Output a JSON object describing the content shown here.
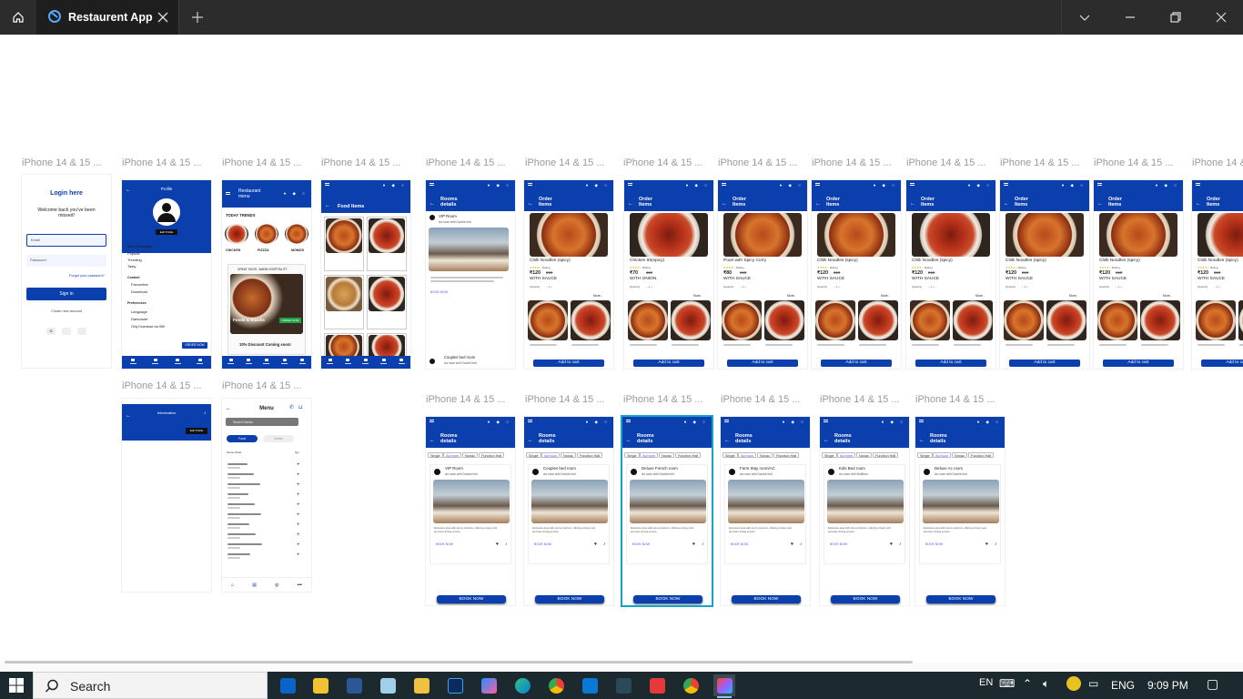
{
  "window": {
    "tab_title": "Restaurent App",
    "brand_color": "#0b3fae",
    "selection_color": "#12a3cf"
  },
  "canvas": {
    "frame_label": "iPhone 14 & 15 ...",
    "login": {
      "title": "Login here",
      "subtitle": "Welcome back you've been missed!",
      "email_placeholder": "Email",
      "password_placeholder": "Password",
      "forgot": "Forgot your password?",
      "signin": "Sign in",
      "create": "Create new account"
    },
    "profile": {
      "title": "Profile",
      "edit": "Edit Profile",
      "section_most": "Most Favourites",
      "most_items": [
        "Popular",
        "Trending",
        "Tasty"
      ],
      "section_content": "Content",
      "content_items": [
        "Favourites",
        "Download"
      ],
      "section_pref": "Preferences",
      "pref_items": [
        "Language",
        "Darkmode",
        "Only Download via Wifi"
      ],
      "order_btn": "ORDER NOW"
    },
    "restaurant_menu": {
      "title": "Restaurant menu",
      "trends": "TODAY TRENDS",
      "dishes": [
        "CHICKEN",
        "PIZZZA",
        "MOMOS"
      ],
      "tagline": "GREAT TASTE, WARM HOSPITALITY",
      "banner": "Foods & Snacks",
      "banner_btn": "ORDER NOW",
      "discount": "10% Discount Coming soon!"
    },
    "food_items": {
      "title": "Food Items"
    },
    "rooms_details": {
      "title": "Rooms details",
      "room1": "VIP Room",
      "room1_sub": "Aa room with Double bed",
      "book_link": "BOOK NOW",
      "room2": "Couples bed room",
      "room2_sub": "Aa room with Double bed"
    },
    "order_items": {
      "title": "Order Items",
      "more": "More..",
      "quantity": "Quantity",
      "rating": "Rating",
      "add_to_cart": "Add to cart",
      "cards": [
        {
          "name": "Chilli Noodles (spicy)",
          "price": "₹120",
          "old": "210",
          "extra": "WITH SAUCE"
        },
        {
          "name": "Chicken 65(spicy)",
          "price": "₹70",
          "old": "110",
          "extra": "WITH ONION"
        },
        {
          "name": "Poori with Spicy Curry",
          "price": "₹80",
          "old": "210",
          "extra": "WITH SAUCE"
        },
        {
          "name": "Chilli Noodles (spicy)",
          "price": "₹120",
          "old": "210",
          "extra": "WITH SAUCE"
        },
        {
          "name": "Chilli Noodles (spicy)",
          "price": "₹120",
          "old": "210",
          "extra": "WITH SAUCE"
        },
        {
          "name": "Chilli Noodles (spicy)",
          "price": "₹120",
          "old": "210",
          "extra": "WITH SAUCE"
        },
        {
          "name": "Chilli Noodles (spicy)",
          "price": "₹120",
          "old": "210",
          "extra": "WITH SAUCE"
        },
        {
          "name": "Chilli Noodles (spicy)",
          "price": "₹120",
          "old": "210",
          "extra": "WITH SAUCE"
        }
      ]
    },
    "information": {
      "title": "Information",
      "edit": "Edit Profile"
    },
    "menu": {
      "title": "Menu",
      "search": "Search Dishes",
      "tab_food": "Food",
      "tab_drinks": "Drinks",
      "col_header": "Name Order",
      "col_qty": "Qty"
    },
    "rooms_list": {
      "title": "Rooms details",
      "chips": [
        "Single",
        "Ac/room",
        "Nonac",
        "Function Hall"
      ],
      "book_now": "BOOK NOW",
      "book_link": "BOOK NOW",
      "desc": "Exclusive area with luxury interiors, offering privacy and premium dining service.",
      "rooms": [
        {
          "name": "VIP Room",
          "sub": "Aa room with Double bed"
        },
        {
          "name": "Couples bed room",
          "sub": "Aa room with Double bed"
        },
        {
          "name": "Deluxe French room",
          "sub": "Aa room with Double bed"
        },
        {
          "name": "Farm Stay room/AC",
          "sub": "Aa room with Double bed"
        },
        {
          "name": "Kids Bed room",
          "sub": "Aa room with Multibed"
        },
        {
          "name": "Deluxe Ac room",
          "sub": "Aa room with Double bed"
        }
      ]
    }
  },
  "taskbar": {
    "search_label": "Search",
    "lang_top": "EN",
    "lang": "ENG",
    "time": "9:09 PM"
  }
}
